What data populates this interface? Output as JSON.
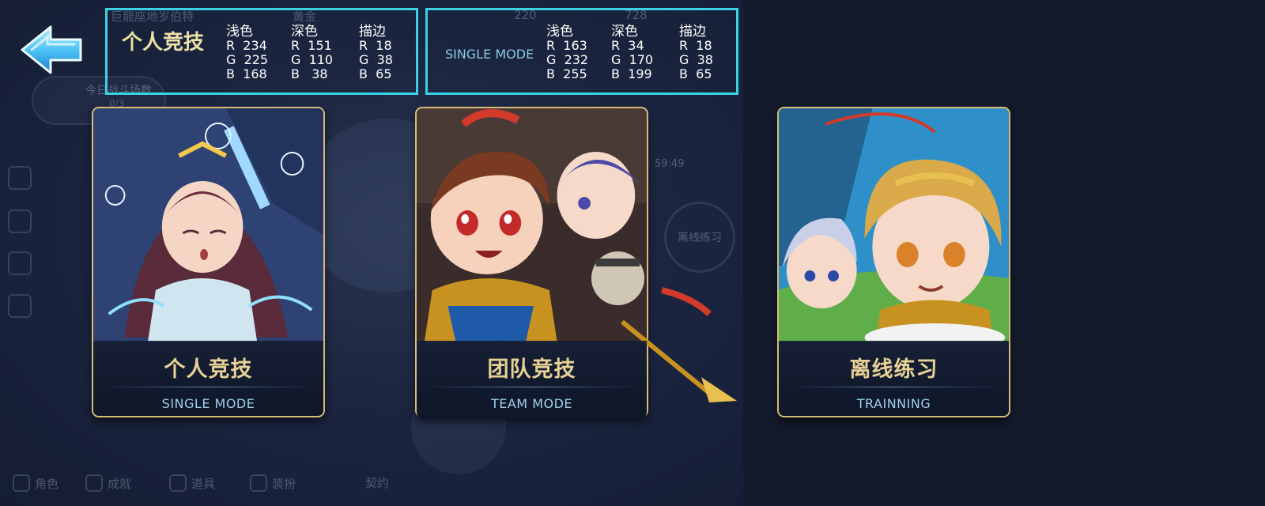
{
  "background": {
    "top_left_text": "巨龍座地岁伯特",
    "top_item": "黄金",
    "top_num_1": "220",
    "top_num_2": "728",
    "daily_label": "今日战斗场数",
    "daily_value": "0/3",
    "timer": "59:49",
    "offline_button": "离线练习",
    "bottom_nav": [
      "角色",
      "成就",
      "道具",
      "装扮"
    ],
    "bottom_contract": "契约"
  },
  "info_left": {
    "title": "个人竞技",
    "columns": [
      {
        "header": "浅色",
        "values": "R  234\nG  225\nB  168"
      },
      {
        "header": "深色",
        "values": "R  151\nG  110\nB   38"
      },
      {
        "header": "描边",
        "values": "R  18\nG  38\nB  65"
      }
    ]
  },
  "info_right": {
    "title": "SINGLE MODE",
    "columns": [
      {
        "header": "浅色",
        "values": "R  163\nG  232\nB  255"
      },
      {
        "header": "深色",
        "values": "R  34\nG  170\nB  199"
      },
      {
        "header": "描边",
        "values": "R  18\nG  38\nB  65"
      }
    ]
  },
  "cards": [
    {
      "title": "个人竞技",
      "subtitle": "SINGLE MODE"
    },
    {
      "title": "团队竞技",
      "subtitle": "TEAM MODE"
    },
    {
      "title": "离线练习",
      "subtitle": "TRAINNING"
    }
  ],
  "colors": {
    "accent_cyan": "#39d3e4",
    "card_border": "#d8bb77",
    "title_gold": "#e8d196",
    "subtitle_blue": "#9cd0e8",
    "back_arrow": "#4fc3f7"
  },
  "icons": {
    "back": "back-arrow-icon"
  }
}
